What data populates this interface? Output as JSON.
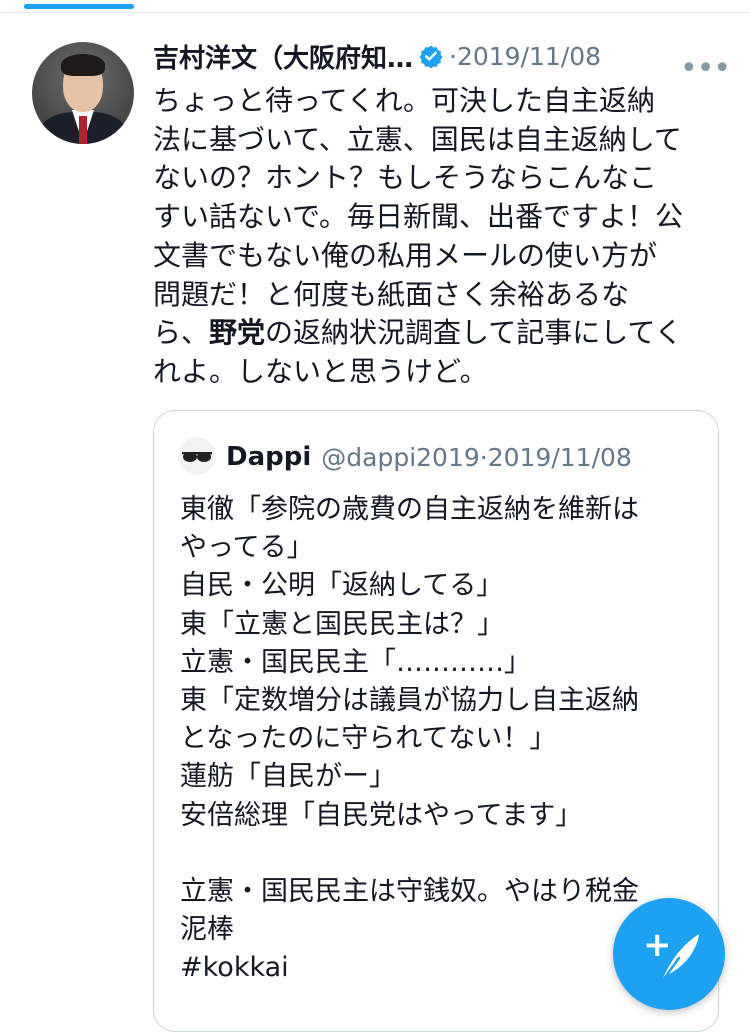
{
  "tweet": {
    "author_name": "吉村洋文（大阪府知…",
    "date": "2019/11/08",
    "separator": "·",
    "lines": [
      "ちょっと待ってくれ。可決した自主返納",
      "法に基づいて、立憲、国民は自主返納して",
      "ないの？ホント？もしそうならこんなこ",
      "すい話ないで。毎日新聞、出番ですよ！公",
      "文書でもない俺の私用メールの使い方が",
      "問題だ！と何度も紙面さく余裕あるな"
    ],
    "line7_pre": "ら、",
    "line7_bold": "野党",
    "line7_post": "の返納状況調査して記事にしてく",
    "line8": "れよ。しないと思うけど。"
  },
  "quote": {
    "name": "Dappi",
    "handle": "@dappi2019",
    "separator": "·",
    "date": "2019/11/08",
    "lines": [
      "東徹「参院の歳費の自主返納を維新は",
      "やってる」",
      "自民・公明「返納してる」",
      "東「立憲と国民民主は？」",
      "立憲・国民民主「…………」",
      "東「定数増分は議員が協力し自主返納",
      "となったのに守られてない！」",
      "蓮舫「自民がー」",
      "安倍総理「自民党はやってます」",
      "",
      "立憲・国民民主は守銭奴。やはり税金",
      "泥棒",
      "#kokkai"
    ]
  },
  "icons": {
    "verified": "verified-badge-icon",
    "more": "more-options-icon",
    "compose": "compose-tweet-icon"
  },
  "colors": {
    "accent": "#1da1f2",
    "secondary_text": "#657786",
    "border": "#ccd6dd"
  }
}
